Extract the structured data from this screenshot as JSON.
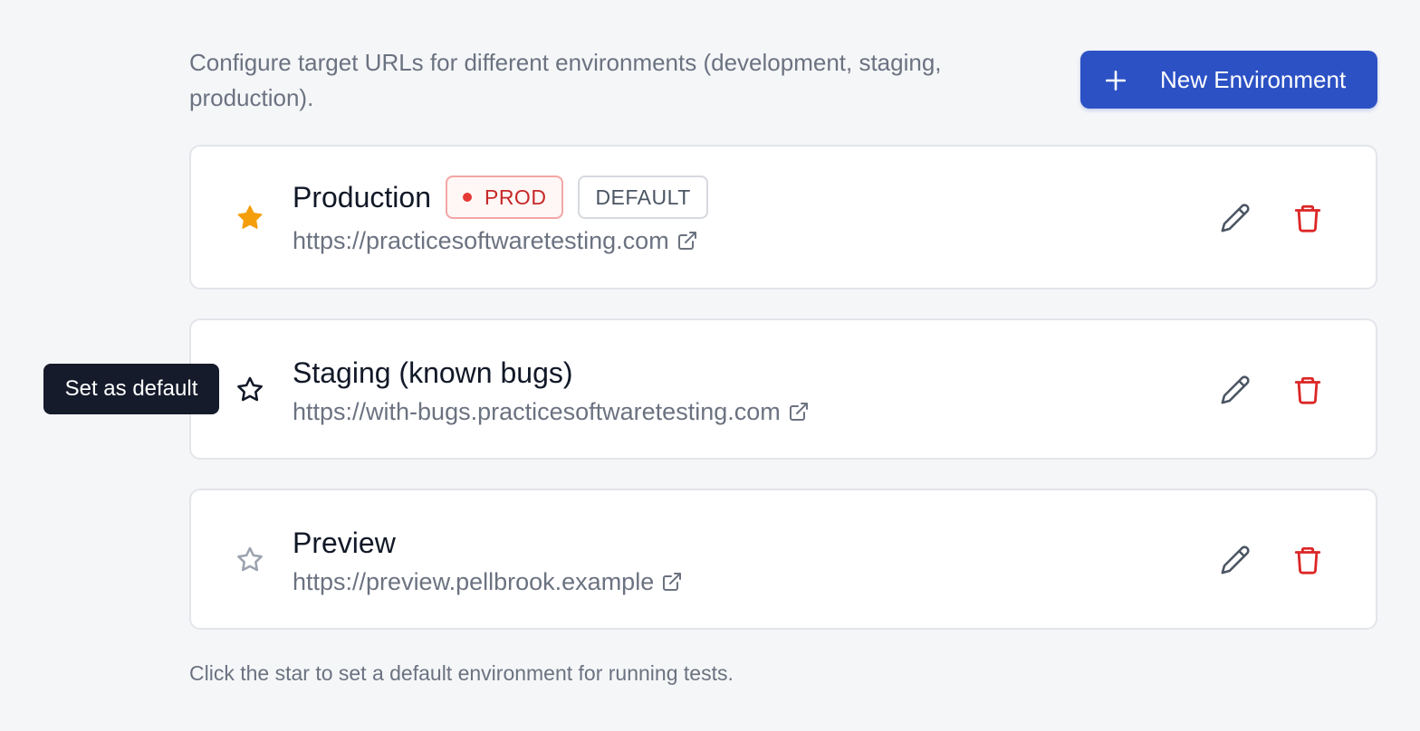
{
  "description": "Configure target URLs for different environments (development, staging, production).",
  "new_environment_button": {
    "label": "New Environment",
    "icon": "plus-icon"
  },
  "environments": [
    {
      "name": "Production",
      "url": "https://practicesoftwaretesting.com",
      "is_default": true,
      "badges": {
        "prod": "PROD",
        "default": "DEFAULT"
      },
      "star_icon": "star-filled-icon"
    },
    {
      "name": "Staging (known bugs)",
      "url": "https://with-bugs.practicesoftwaretesting.com",
      "is_default": false,
      "star_icon": "star-outline-icon"
    },
    {
      "name": "Preview",
      "url": "https://preview.pellbrook.example",
      "is_default": false,
      "star_icon": "star-outline-icon"
    }
  ],
  "tooltip": "Set as default",
  "footer_hint": "Click the star to set a default environment for running tests.",
  "colors": {
    "accent": "#2c51c4",
    "star_active": "#f59e0b",
    "delete": "#dc2626",
    "prod_badge": "#c62828",
    "tooltip_bg": "#151b2b"
  }
}
